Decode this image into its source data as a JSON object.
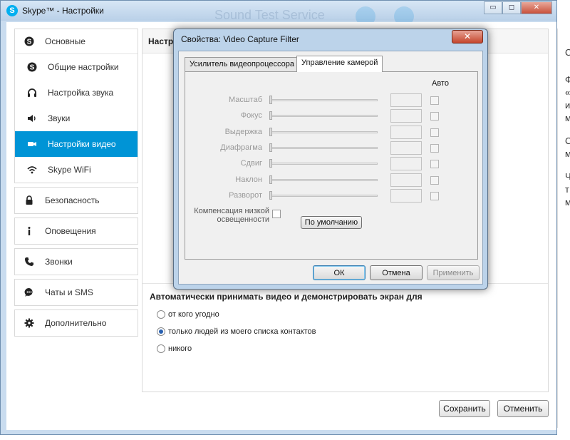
{
  "window": {
    "title": "Skype™ - Настройки",
    "logo": "S",
    "background_text": "Sound Test Service",
    "controls": {
      "minimize": "▭",
      "maximize": "◻",
      "close": "✕"
    }
  },
  "sidebar": {
    "group_main": {
      "head": {
        "label": "Основные",
        "icon": "skype-icon"
      },
      "items": [
        {
          "label": "Общие настройки",
          "icon": "skype-icon"
        },
        {
          "label": "Настройка звука",
          "icon": "headset-icon"
        },
        {
          "label": "Звуки",
          "icon": "speaker-icon"
        },
        {
          "label": "Настройки видео",
          "icon": "camera-icon",
          "active": true
        },
        {
          "label": "Skype WiFi",
          "icon": "wifi-icon"
        }
      ]
    },
    "others": [
      {
        "label": "Безопасность",
        "icon": "lock-icon"
      },
      {
        "label": "Оповещения",
        "icon": "info-icon"
      },
      {
        "label": "Звонки",
        "icon": "phone-icon"
      },
      {
        "label": "Чаты и SMS",
        "icon": "chat-icon"
      },
      {
        "label": "Дополнительно",
        "icon": "gear-icon"
      }
    ]
  },
  "main": {
    "header": "Настро",
    "section_title": "Автоматически принимать видео и демонстрировать экран для",
    "options": [
      {
        "label": "от кого угодно",
        "selected": false
      },
      {
        "label": "только людей из моего списка контактов",
        "selected": true
      },
      {
        "label": "никого",
        "selected": false
      }
    ],
    "save_label": "Сохранить",
    "cancel_label": "Отменить"
  },
  "right_cut": [
    "С",
    "Ф",
    "«",
    "и",
    "м",
    "С",
    "м",
    "Ч",
    "т",
    "м"
  ],
  "dialog": {
    "title": "Свойства: Video Capture Filter",
    "close": "✕",
    "tabs": [
      {
        "label": "Усилитель видеопроцессора",
        "active": false
      },
      {
        "label": "Управление камерой",
        "active": true
      }
    ],
    "auto_label": "Авто",
    "controls": [
      "Масштаб",
      "Фокус",
      "Выдержка",
      "Диафрагма",
      "Сдвиг",
      "Наклон",
      "Разворот"
    ],
    "low_light_line1": "Компенсация низкой",
    "low_light_line2": "освещенности",
    "default_label": "По умолчанию",
    "ok_label": "ОК",
    "cancel_label": "Отмена",
    "apply_label": "Применить"
  }
}
